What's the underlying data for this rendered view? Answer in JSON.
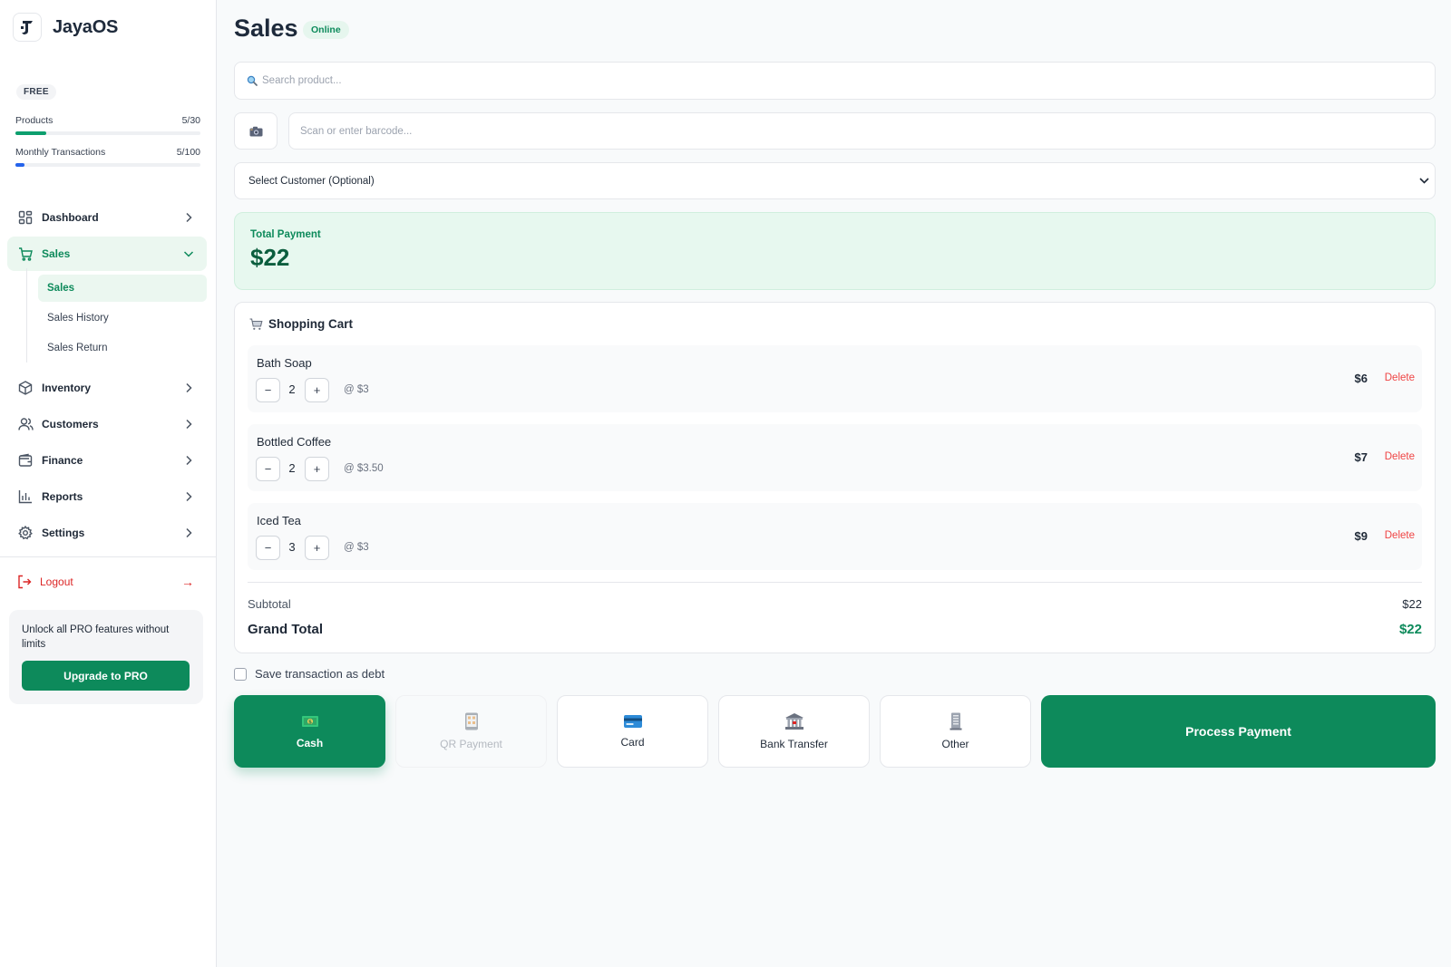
{
  "brand": {
    "name": "JayaOS"
  },
  "plan": {
    "badge": "FREE",
    "products": {
      "label": "Products",
      "value": "5/30",
      "fraction": 0.167,
      "color": "#0d9f6e"
    },
    "transactions": {
      "label": "Monthly Transactions",
      "value": "5/100",
      "fraction": 0.05,
      "color": "#2563eb"
    }
  },
  "sidebar": {
    "items": [
      {
        "label": "Dashboard",
        "icon": "dashboard-icon"
      },
      {
        "label": "Sales",
        "icon": "cart-icon"
      },
      {
        "label": "Inventory",
        "icon": "box-icon"
      },
      {
        "label": "Customers",
        "icon": "users-icon"
      },
      {
        "label": "Finance",
        "icon": "wallet-icon"
      },
      {
        "label": "Reports",
        "icon": "bar-chart-icon"
      },
      {
        "label": "Settings",
        "icon": "gear-icon"
      }
    ],
    "sales_sub": [
      "Sales",
      "Sales History",
      "Sales Return"
    ],
    "logout": "Logout",
    "promo_text": "Unlock all PRO features without limits",
    "promo_button": "Upgrade to PRO"
  },
  "page": {
    "title": "Sales",
    "status": "Online"
  },
  "search": {
    "placeholder": "Search product..."
  },
  "barcode": {
    "placeholder": "Scan or enter barcode..."
  },
  "customer_select": {
    "value": "Select Customer (Optional)"
  },
  "total": {
    "label": "Total Payment",
    "amount": "$22"
  },
  "cart": {
    "title": "Shopping Cart",
    "items": [
      {
        "name": "Bath Soap",
        "qty": "2",
        "unit": "@ $3",
        "total": "$6",
        "delete": "Delete"
      },
      {
        "name": "Bottled Coffee",
        "qty": "2",
        "unit": "@ $3.50",
        "total": "$7",
        "delete": "Delete"
      },
      {
        "name": "Iced Tea",
        "qty": "3",
        "unit": "@ $3",
        "total": "$9",
        "delete": "Delete"
      }
    ],
    "minus": "−",
    "plus": "+",
    "subtotal_label": "Subtotal",
    "subtotal": "$22",
    "grand_total_label": "Grand Total",
    "grand_total": "$22"
  },
  "debt_label": "Save transaction as debt",
  "payment_methods": [
    {
      "label": "Cash",
      "icon": "cash-icon",
      "state": "selected"
    },
    {
      "label": "QR Payment",
      "icon": "qr-phone-icon",
      "state": "disabled"
    },
    {
      "label": "Card",
      "icon": "credit-card-icon",
      "state": "normal"
    },
    {
      "label": "Bank Transfer",
      "icon": "bank-icon",
      "state": "normal"
    },
    {
      "label": "Other",
      "icon": "other-icon",
      "state": "normal"
    }
  ],
  "process_button": "Process Payment",
  "colors": {
    "accent": "#0d8a5b",
    "danger": "#ef4444",
    "total_bg": "#e7f8ef"
  }
}
